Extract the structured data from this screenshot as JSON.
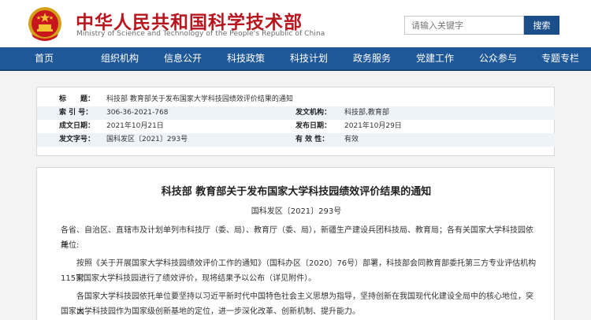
{
  "header": {
    "title": "中华人民共和国科学技术部",
    "subtitle": "Ministry of Science and Technology of the People's Republic of China",
    "search_placeholder": "请输入关键字",
    "search_button": "搜索"
  },
  "nav": [
    {
      "label": "首页"
    },
    {
      "label": "组织机构"
    },
    {
      "label": "信息公开"
    },
    {
      "label": "科技政策"
    },
    {
      "label": "科技计划"
    },
    {
      "label": "政务服务"
    },
    {
      "label": "党建工作"
    },
    {
      "label": "公众参与"
    },
    {
      "label": "专题专栏"
    }
  ],
  "meta": {
    "title_label": "标　　题：",
    "title_value": "科技部 教育部关于发布国家大学科技园绩效评价结果的通知",
    "index_label": "索 引 号：",
    "index_value": "306-36-2021-768",
    "issuer_label": "发文机构：",
    "issuer_value": "科技部,教育部",
    "created_label": "成文日期：",
    "created_value": "2021年10月21日",
    "published_label": "发布日期：",
    "published_value": "2021年10月29日",
    "docno_label": "发文字号：",
    "docno_value": "国科发区〔2021〕293号",
    "validity_label": "有 效 性：",
    "validity_value": "有效"
  },
  "article": {
    "title": "科技部 教育部关于发布国家大学科技园绩效评价结果的通知",
    "doc_no": "国科发区〔2021〕293号",
    "p1_line1": "各省、自治区、直辖市及计划单列市科技厅（委、局）、教育厅（委、局），新疆生产建设兵团科技局、教育局；各有关国家大学科技园依托",
    "p1_line2": "单位:",
    "p2_line1": "按照《关于开展国家大学科技园绩效评价工作的通知》（国科办区〔2020〕76号）部署，科技部会同教育部委托第三方专业评估机构对",
    "p2_line2": "115家国家大学科技园进行了绩效评价，现将结果予以公布（详见附件）。",
    "p3_line1": "各国家大学科技园依托单位要坚持以习近平新时代中国特色社会主义思想为指导，坚持创新在我国现代化建设全局中的核心地位，突出",
    "p3_line2": "国家大学科技园作为国家级创新基地的定位，进一步深化改革、创新机制、提升能力。"
  },
  "colors": {
    "brand_red": "#b8161f",
    "nav_blue": "#1f5898",
    "meta_shade": "#eef3fa"
  }
}
